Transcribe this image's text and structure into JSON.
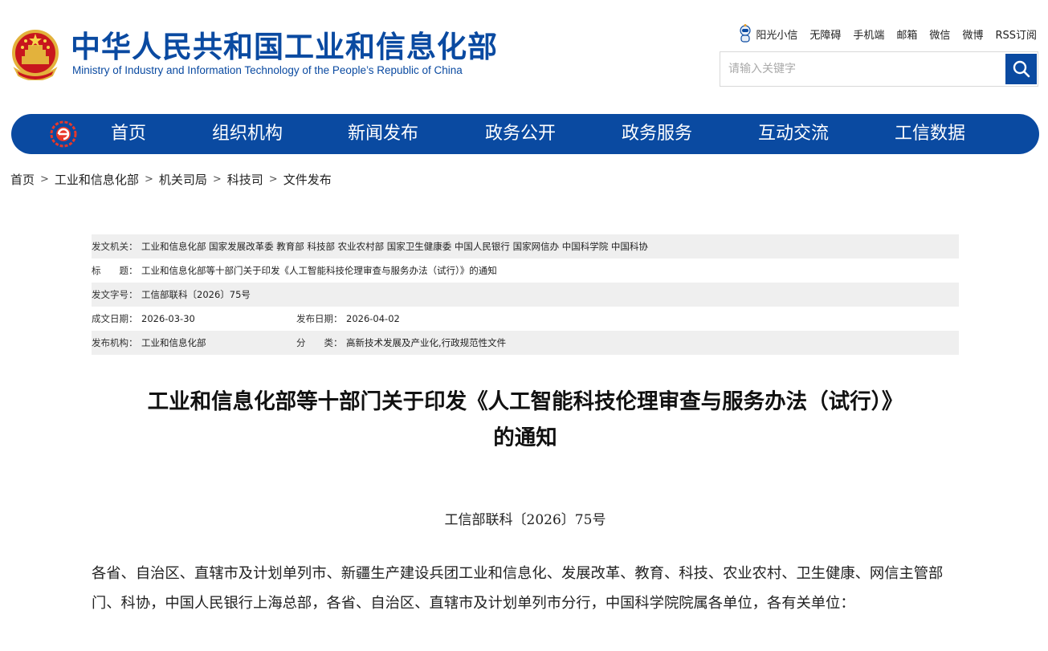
{
  "header": {
    "site_name": "中华人民共和国工业和信息化部",
    "site_name_en": "Ministry of Industry and Information Technology of the People’s Republic of China",
    "emblem_icon": "national-emblem-icon",
    "top_links": [
      "阳光小信",
      "无障碍",
      "手机端",
      "邮箱",
      "微信",
      "微博",
      "RSS订阅"
    ],
    "search": {
      "placeholder": "请输入关键字",
      "value": ""
    }
  },
  "nav": {
    "logo_icon": "miit-logo-icon",
    "items": [
      "首页",
      "组织机构",
      "新闻发布",
      "政务公开",
      "政务服务",
      "互动交流",
      "工信数据"
    ]
  },
  "breadcrumb": [
    "首页",
    "工业和信息化部",
    "机关司局",
    "科技司",
    "文件发布"
  ],
  "meta": {
    "issuer_label": "发文机关：",
    "issuer": "工业和信息化部 国家发展改革委 教育部 科技部 农业农村部 国家卫生健康委 中国人民银行 国家网信办 中国科学院 中国科协",
    "title_label": "标　　题：",
    "title": "工业和信息化部等十部门关于印发《人工智能科技伦理审查与服务办法（试行）》的通知",
    "docno_label": "发文字号：",
    "docno": "工信部联科〔2026〕75号",
    "created_label": "成文日期：",
    "created": "2026-03-30",
    "published_label": "发布日期：",
    "published": "2026-04-02",
    "org_label": "发布机构：",
    "org": "工业和信息化部",
    "category_label": "分　　类：",
    "category": "高新技术发展及产业化,行政规范性文件"
  },
  "article": {
    "title_line1": "工业和信息化部等十部门关于印发《人工智能科技伦理审查与服务办法（试行）》",
    "title_line2": "的通知",
    "docno": "工信部联科〔2026〕75号",
    "salutation": "各省、自治区、直辖市及计划单列市、新疆生产建设兵团工业和信息化、发展改革、教育、科技、农业农村、卫生健康、网信主管部门、科协，中国人民银行上海总部，各省、自治区、直辖市及计划单列市分行，中国科学院院属各单位，各有关单位："
  },
  "colors": {
    "brand_blue": "#0a4aa1",
    "nav_text": "#ffffff",
    "meta_shade": "#efefef"
  }
}
